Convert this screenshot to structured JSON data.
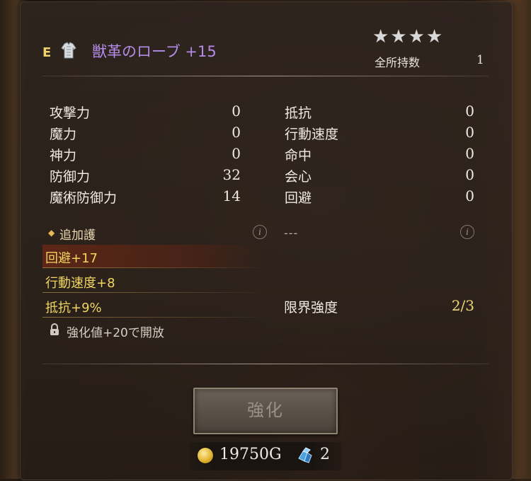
{
  "item": {
    "rank": "E",
    "icon": "robe-armor-icon",
    "name": "獣革のローブ +15",
    "stars": "★★★★",
    "owned_label": "全所持数",
    "owned_count": "1"
  },
  "stats_left": [
    {
      "label": "攻撃力",
      "value": "0"
    },
    {
      "label": "魔力",
      "value": "0"
    },
    {
      "label": "神力",
      "value": "0"
    },
    {
      "label": "防御力",
      "value": "32"
    },
    {
      "label": "魔術防御力",
      "value": "14"
    }
  ],
  "stats_right": [
    {
      "label": "抵抗",
      "value": "0"
    },
    {
      "label": "行動速度",
      "value": "0"
    },
    {
      "label": "命中",
      "value": "0"
    },
    {
      "label": "会心",
      "value": "0"
    },
    {
      "label": "回避",
      "value": "0"
    }
  ],
  "additional": {
    "header": "追加護",
    "right_placeholder": "---",
    "options": [
      "回避+17",
      "行動速度+8",
      "抵抗+9%"
    ],
    "lock_text": "強化値+20で開放"
  },
  "limit": {
    "label": "限界強度",
    "value": "2/3"
  },
  "enhance_button": "強化",
  "cost": {
    "gold": "19750G",
    "stones": "2"
  },
  "colors": {
    "item_name": "#b58be8",
    "option_text": "#f0d660",
    "rank": "#f2d36b"
  }
}
